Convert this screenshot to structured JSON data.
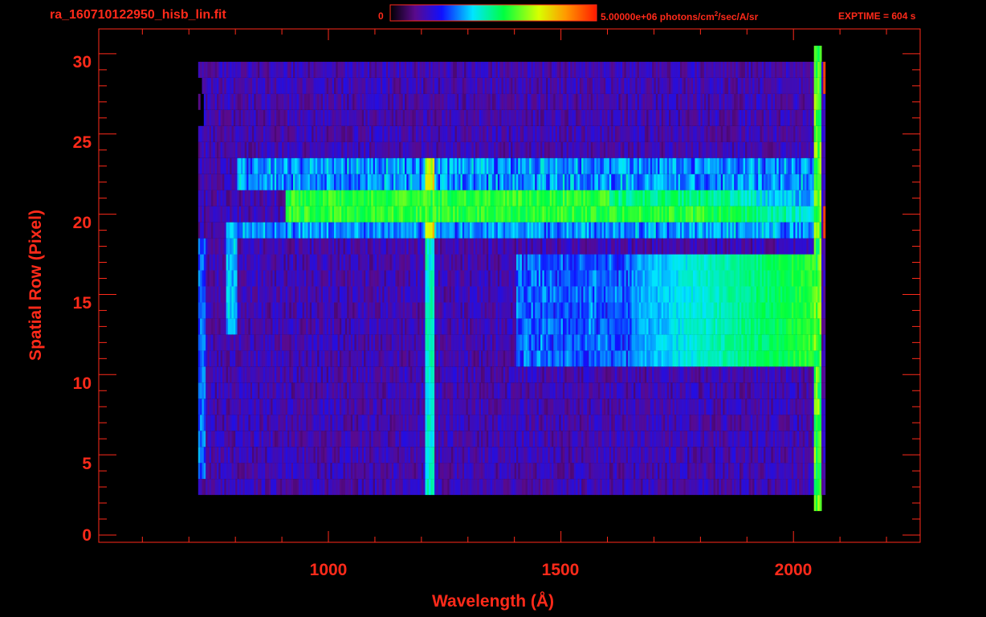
{
  "header": {
    "title": "ra_160710122950_hisb_lin.fit",
    "colorbar_min_label": "0",
    "colorbar_max_value": "5.00000e+06 photons/cm",
    "colorbar_max_sup": "2",
    "colorbar_max_unit": "/sec/A/sr",
    "exptime": "EXPTIME = 604 s"
  },
  "colors": {
    "axis": "#ff2a1a",
    "background": "#000000"
  },
  "chart_data": {
    "type": "heatmap",
    "xlabel": "Wavelength (Å)",
    "ylabel": "Spatial Row (Pixel)",
    "xlim": [
      550,
      2300
    ],
    "ylim": [
      0,
      30
    ],
    "xticks": [
      "1000",
      "1500",
      "2000"
    ],
    "yticks": [
      "0",
      "5",
      "10",
      "15",
      "20",
      "25",
      "30"
    ],
    "xtick_values": [
      1000,
      1500,
      2000
    ],
    "ytick_values": [
      0,
      5,
      10,
      15,
      20,
      25,
      30
    ],
    "colorscale": {
      "min": 0,
      "max": 5000000,
      "palette": "rainbow"
    },
    "features": [
      {
        "name": "emission-line",
        "x": 1216,
        "rows": [
          3,
          24
        ]
      },
      {
        "name": "bright-band",
        "rows": [
          20,
          22
        ],
        "x_start": 905,
        "x_end": 2060
      },
      {
        "name": "continuum-region",
        "rows": [
          11,
          18
        ],
        "x_start": 1700,
        "x_end": 2060
      },
      {
        "name": "faint-line",
        "x": 790,
        "rows": [
          13,
          20
        ]
      },
      {
        "name": "edge-line",
        "x": 2055,
        "rows": [
          2,
          30
        ]
      }
    ]
  }
}
